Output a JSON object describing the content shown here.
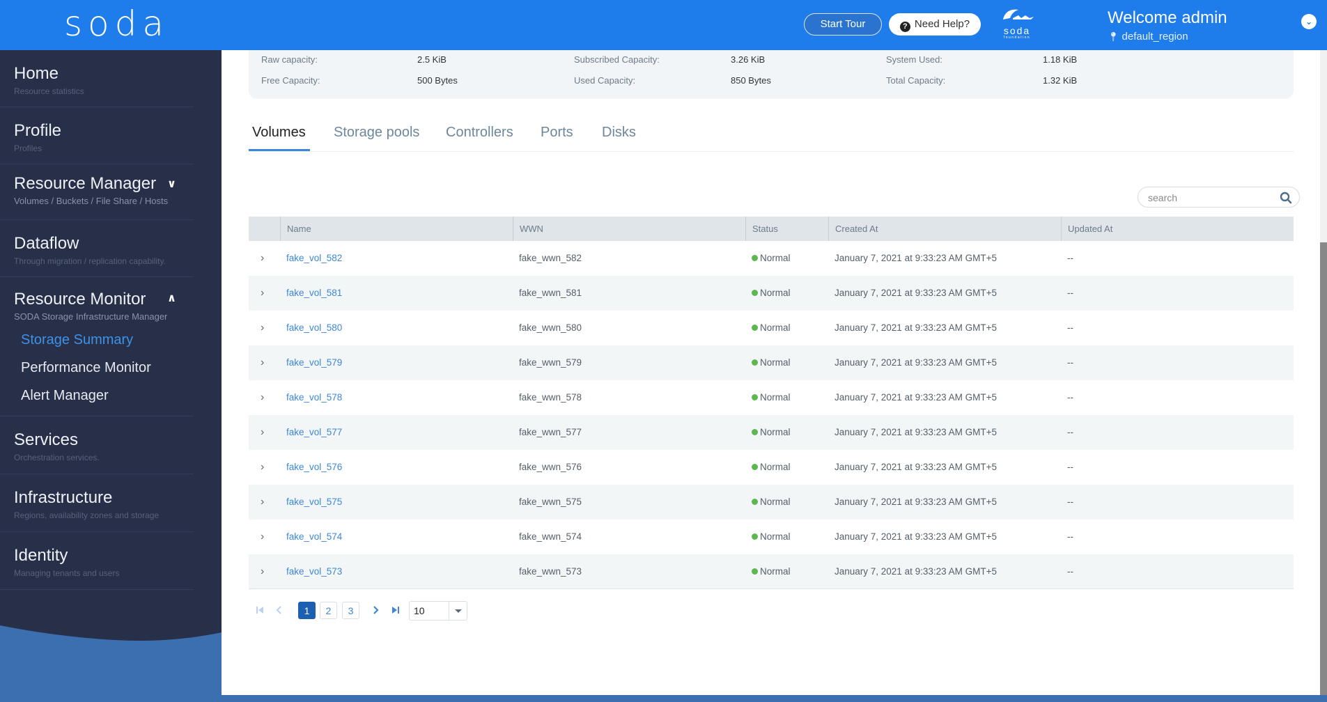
{
  "header": {
    "logo": "soda",
    "start_tour": "Start Tour",
    "need_help": "Need Help?",
    "foundation_logo_name": "soda",
    "foundation_logo_sub": "foundation",
    "welcome": "Welcome admin",
    "region": "default_region",
    "icons": {
      "help": "question-circle-icon",
      "region": "map-pin-icon",
      "user_menu": "chevron-down-circle-icon"
    }
  },
  "sidebar": {
    "items": [
      {
        "title": "Home",
        "subtitle": "Resource statistics"
      },
      {
        "title": "Profile",
        "subtitle": "Profiles"
      },
      {
        "title": "Resource Manager",
        "subtitle": "Volumes / Buckets / File Share / Hosts",
        "expanded": false
      },
      {
        "title": "Dataflow",
        "subtitle": "Through migration / replication capability."
      },
      {
        "title": "Resource Monitor",
        "subtitle": "SODA Storage Infrastructure Manager",
        "expanded": true
      },
      {
        "title": "Services",
        "subtitle": "Orchestration services."
      },
      {
        "title": "Infrastructure",
        "subtitle": "Regions, availability zones and storage"
      },
      {
        "title": "Identity",
        "subtitle": "Managing tenants and users"
      }
    ],
    "resource_monitor_children": [
      {
        "label": "Storage Summary",
        "active": true
      },
      {
        "label": "Performance Monitor",
        "active": false
      },
      {
        "label": "Alert Manager",
        "active": false
      }
    ]
  },
  "summary": {
    "raw_capacity_label": "Raw capacity:",
    "raw_capacity": "2.5 KiB",
    "free_capacity_label": "Free Capacity:",
    "free_capacity": "500 Bytes",
    "subscribed_capacity_label": "Subscribed Capacity:",
    "subscribed_capacity": "3.26 KiB",
    "used_capacity_label": "Used Capacity:",
    "used_capacity": "850 Bytes",
    "system_used_label": "System Used:",
    "system_used": "1.18 KiB",
    "total_capacity_label": "Total Capacity:",
    "total_capacity": "1.32 KiB"
  },
  "tabs": [
    {
      "label": "Volumes",
      "active": true
    },
    {
      "label": "Storage pools",
      "active": false
    },
    {
      "label": "Controllers",
      "active": false
    },
    {
      "label": "Ports",
      "active": false
    },
    {
      "label": "Disks",
      "active": false
    }
  ],
  "search": {
    "placeholder": "search",
    "value": ""
  },
  "table": {
    "columns": [
      "Name",
      "WWN",
      "Status",
      "Created At",
      "Updated At"
    ],
    "rows": [
      {
        "name": "fake_vol_582",
        "wwn": "fake_wwn_582",
        "status": "Normal",
        "created": "January 7, 2021 at 9:33:23 AM GMT+5",
        "updated": "--"
      },
      {
        "name": "fake_vol_581",
        "wwn": "fake_wwn_581",
        "status": "Normal",
        "created": "January 7, 2021 at 9:33:23 AM GMT+5",
        "updated": "--"
      },
      {
        "name": "fake_vol_580",
        "wwn": "fake_wwn_580",
        "status": "Normal",
        "created": "January 7, 2021 at 9:33:23 AM GMT+5",
        "updated": "--"
      },
      {
        "name": "fake_vol_579",
        "wwn": "fake_wwn_579",
        "status": "Normal",
        "created": "January 7, 2021 at 9:33:23 AM GMT+5",
        "updated": "--"
      },
      {
        "name": "fake_vol_578",
        "wwn": "fake_wwn_578",
        "status": "Normal",
        "created": "January 7, 2021 at 9:33:23 AM GMT+5",
        "updated": "--"
      },
      {
        "name": "fake_vol_577",
        "wwn": "fake_wwn_577",
        "status": "Normal",
        "created": "January 7, 2021 at 9:33:23 AM GMT+5",
        "updated": "--"
      },
      {
        "name": "fake_vol_576",
        "wwn": "fake_wwn_576",
        "status": "Normal",
        "created": "January 7, 2021 at 9:33:23 AM GMT+5",
        "updated": "--"
      },
      {
        "name": "fake_vol_575",
        "wwn": "fake_wwn_575",
        "status": "Normal",
        "created": "January 7, 2021 at 9:33:23 AM GMT+5",
        "updated": "--"
      },
      {
        "name": "fake_vol_574",
        "wwn": "fake_wwn_574",
        "status": "Normal",
        "created": "January 7, 2021 at 9:33:23 AM GMT+5",
        "updated": "--"
      },
      {
        "name": "fake_vol_573",
        "wwn": "fake_wwn_573",
        "status": "Normal",
        "created": "January 7, 2021 at 9:33:23 AM GMT+5",
        "updated": "--"
      }
    ],
    "status_color": "#5cb84e"
  },
  "pagination": {
    "pages": [
      "1",
      "2",
      "3"
    ],
    "current_page": "1",
    "rows_per_page": "10"
  },
  "colors": {
    "header": "#1e7ceb",
    "sidebar": "#283049",
    "accent": "#3c87d8",
    "active_page": "#1d5fb0"
  }
}
